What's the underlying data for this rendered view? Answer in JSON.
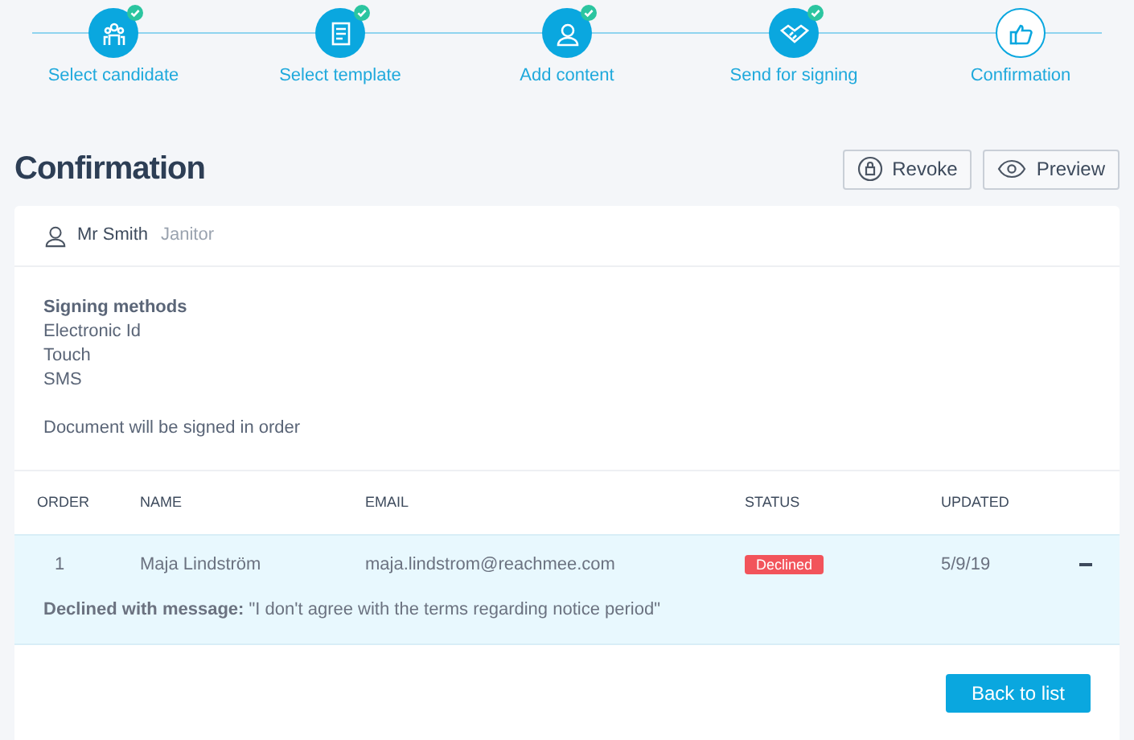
{
  "steps": [
    {
      "label": "Select candidate",
      "completed": true
    },
    {
      "label": "Select template",
      "completed": true
    },
    {
      "label": "Add content",
      "completed": true
    },
    {
      "label": "Send for signing",
      "completed": true
    },
    {
      "label": "Confirmation",
      "completed": false
    }
  ],
  "page_title": "Confirmation",
  "actions": [
    {
      "label": "Revoke"
    },
    {
      "label": "Preview"
    }
  ],
  "candidate": {
    "name": "Mr Smith",
    "role": "Janitor"
  },
  "signing": {
    "heading": "Signing methods",
    "methods": [
      "Electronic Id",
      "Touch",
      "SMS"
    ],
    "note": "Document will be signed in order"
  },
  "table": {
    "columns": [
      "ORDER",
      "NAME",
      "EMAIL",
      "STATUS",
      "UPDATED"
    ],
    "rows": [
      {
        "order": "1",
        "name": "Maja Lindström",
        "email": "maja.lindstrom@reachmee.com",
        "status": "Declined",
        "color": "#f2545b",
        "updated": "5/9/19",
        "expanded": true,
        "message": "**Declined with message:** \"I don't agree with the terms regarding notice period\""
      }
    ]
  },
  "footer_button": "Back to list"
}
